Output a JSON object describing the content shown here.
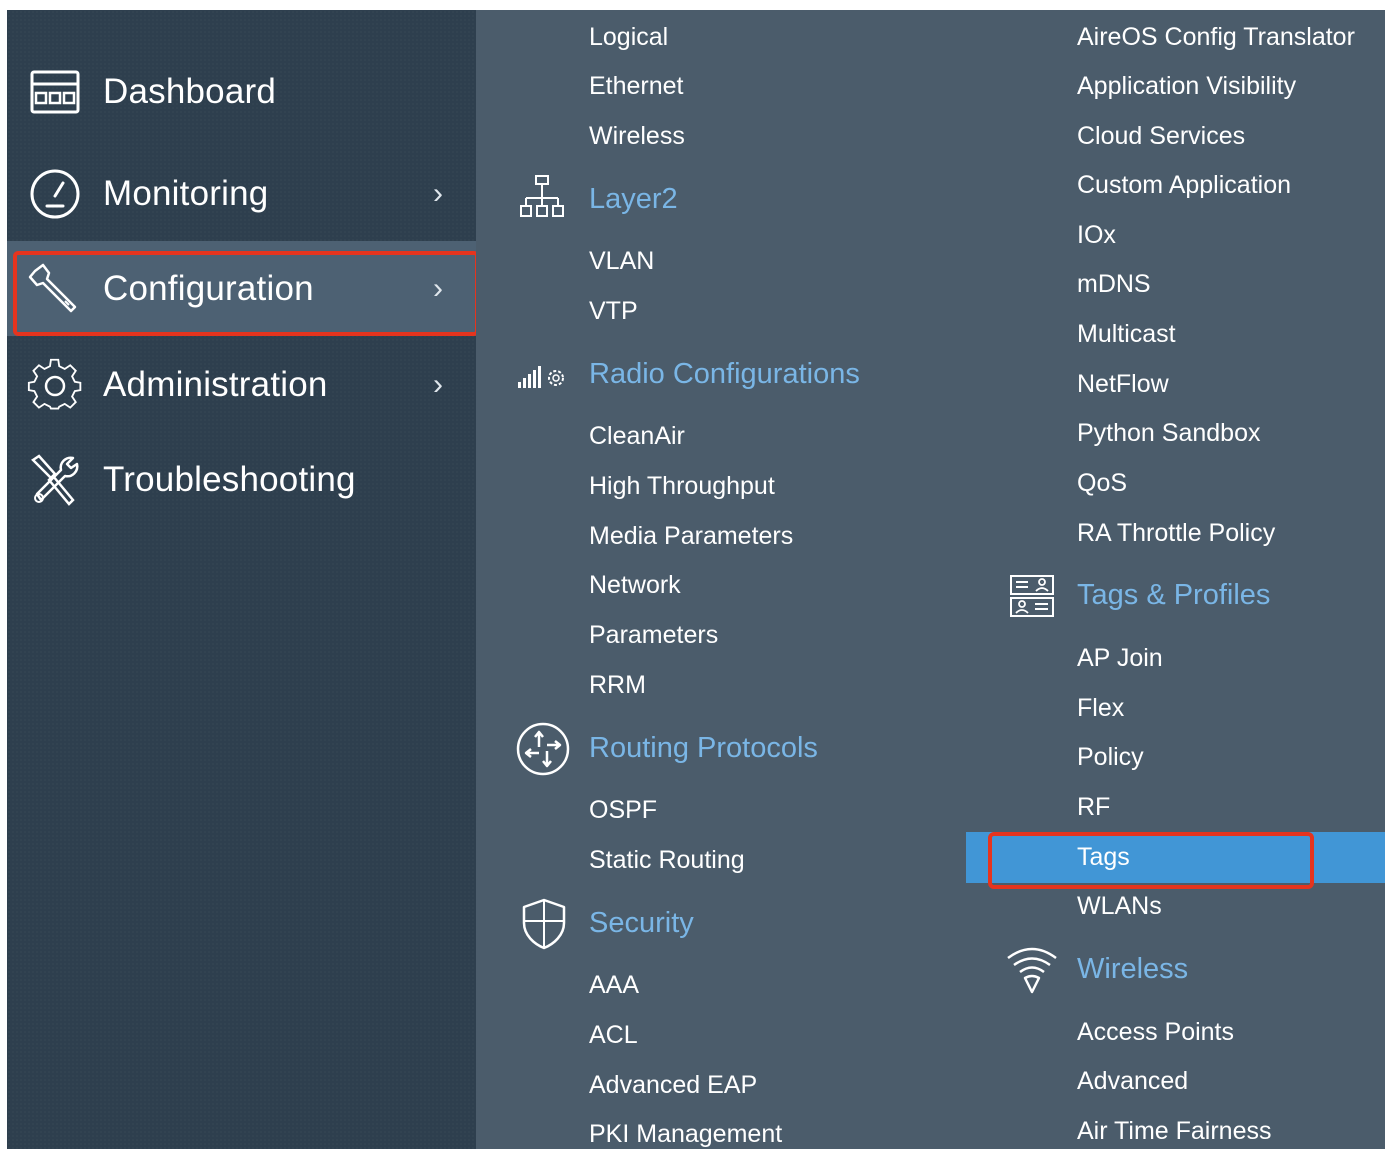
{
  "sidebar": {
    "items": [
      {
        "label": "Dashboard",
        "icon": "dashboard-icon"
      },
      {
        "label": "Monitoring",
        "icon": "speedometer-icon",
        "chevron": "›"
      },
      {
        "label": "Configuration",
        "icon": "wrench-icon",
        "chevron": "›",
        "active": true
      },
      {
        "label": "Administration",
        "icon": "gear-icon",
        "chevron": "›"
      },
      {
        "label": "Troubleshooting",
        "icon": "tools-icon"
      }
    ]
  },
  "submenu": {
    "col1_top": [
      "Logical",
      "Ethernet",
      "Wireless"
    ],
    "layer2": {
      "title": "Layer2",
      "icon": "network-tree-icon",
      "items": [
        "VLAN",
        "VTP"
      ]
    },
    "radio": {
      "title": "Radio Configurations",
      "icon": "signal-gear-icon",
      "items": [
        "CleanAir",
        "High Throughput",
        "Media Parameters",
        "Network",
        "Parameters",
        "RRM"
      ]
    },
    "routing": {
      "title": "Routing Protocols",
      "icon": "router-arrows-icon",
      "items": [
        "OSPF",
        "Static Routing"
      ]
    },
    "security": {
      "title": "Security",
      "icon": "shield-icon",
      "items": [
        "AAA",
        "ACL",
        "Advanced EAP",
        "PKI Management"
      ]
    },
    "col2_top": [
      "AireOS Config Translator",
      "Application Visibility",
      "Cloud Services",
      "Custom Application",
      "IOx",
      "mDNS",
      "Multicast",
      "NetFlow",
      "Python Sandbox",
      "QoS",
      "RA Throttle Policy"
    ],
    "tags_profiles": {
      "title": "Tags & Profiles",
      "icon": "profile-cards-icon",
      "items": [
        "AP Join",
        "Flex",
        "Policy",
        "RF",
        "Tags",
        "WLANs"
      ],
      "selected": "Tags"
    },
    "wireless": {
      "title": "Wireless",
      "icon": "wifi-icon",
      "items": [
        "Access Points",
        "Advanced",
        "Air Time Fairness"
      ]
    }
  },
  "colors": {
    "sidebar_bg": "#2e3f4e",
    "active_bg": "#4d6173",
    "submenu_bg": "#4b5c6b",
    "heading": "#7ab6e6",
    "selected_row": "#4196d6",
    "highlight_border": "#e5341e"
  }
}
